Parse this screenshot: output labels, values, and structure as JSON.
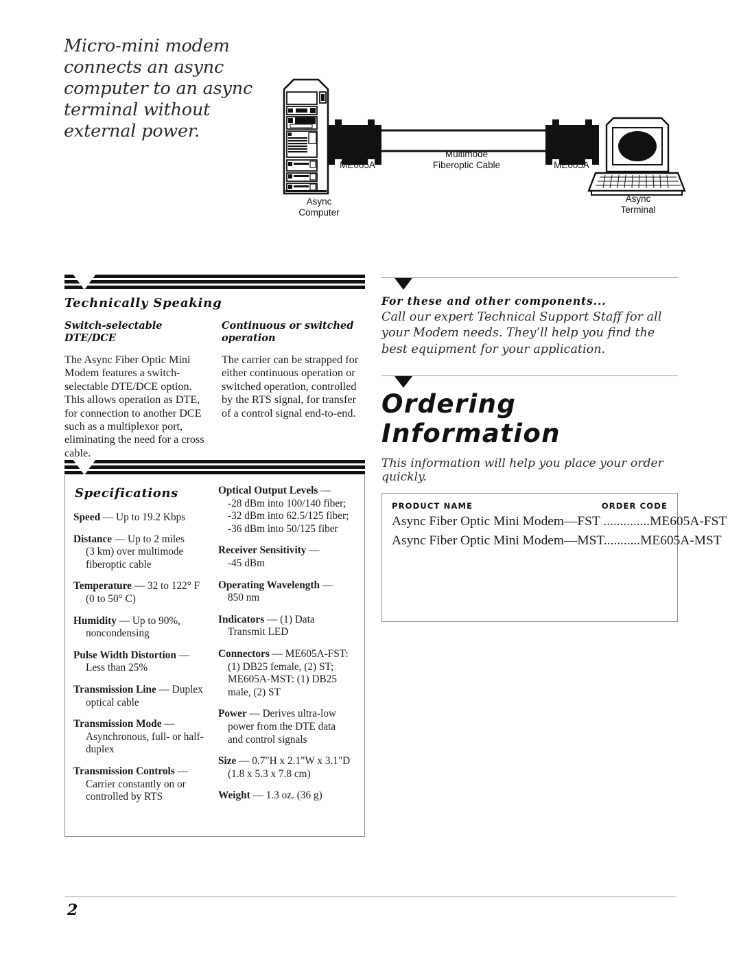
{
  "headline": "Micro-mini modem connects an async computer to an async terminal without external power.",
  "diagram": {
    "labels": [
      {
        "name": "async-computer",
        "text": "Async\nComputer"
      },
      {
        "name": "left-modem",
        "text": "ME605A"
      },
      {
        "name": "fiberoptic-cable",
        "text": "Multimode\nFiberoptic Cable"
      },
      {
        "name": "right-modem",
        "text": "ME605A"
      },
      {
        "name": "async-terminal",
        "text": "Async\nTerminal"
      }
    ]
  },
  "technically_speaking": {
    "title": "Technically Speaking",
    "columns": [
      {
        "subhead": "Switch-selectable DTE/DCE",
        "body": "The Async Fiber Optic Mini Modem features a switch-selectable DTE/DCE option. This allows operation as DTE, for connection to another DCE such as a multiplexor port, eliminating the need for a cross cable."
      },
      {
        "subhead": "Continuous or switched operation",
        "body": "The carrier can be strapped for either continuous operation or switched operation, controlled by the RTS signal, for transfer of a control signal end-to-end."
      }
    ]
  },
  "specifications": {
    "title": "Specifications",
    "left_items": [
      {
        "label": "Speed",
        "value": " — Up to 19.2 Kbps",
        "cont": ""
      },
      {
        "label": "Distance",
        "value": " — Up to 2 miles",
        "cont": "(3 km) over multimode fiberoptic cable"
      },
      {
        "label": "Temperature",
        "value": " — 32 to 122° F",
        "cont": "(0 to 50° C)"
      },
      {
        "label": "Humidity",
        "value": " — Up to 90%,",
        "cont": "noncondensing"
      },
      {
        "label": "Pulse Width Distortion",
        "value": " —",
        "cont": "Less than 25%"
      },
      {
        "label": "Transmission Line",
        "value": " — Duplex",
        "cont": "optical cable"
      },
      {
        "label": "Transmission Mode",
        "value": " —",
        "cont": "Asynchronous, full- or half-duplex"
      },
      {
        "label": "Transmission Controls",
        "value": " —",
        "cont": "Carrier constantly on or controlled by RTS"
      }
    ],
    "right_items": [
      {
        "label": "Optical Output Levels",
        "value": " —",
        "cont": "-28 dBm into 100/140 fiber; -32 dBm into 62.5/125 fiber; -36 dBm into 50/125 fiber"
      },
      {
        "label": "Receiver Sensitivity",
        "value": " —",
        "cont": "-45 dBm"
      },
      {
        "label": "Operating Wavelength",
        "value": " —",
        "cont": "850 nm"
      },
      {
        "label": "Indicators",
        "value": " — (1) Data",
        "cont": "Transmit LED"
      },
      {
        "label": "Connectors",
        "value": " — ME605A-FST:",
        "cont": "(1) DB25 female, (2) ST; ME605A-MST: (1) DB25 male, (2) ST"
      },
      {
        "label": "Power",
        "value": " — Derives ultra-low",
        "cont": "power from the DTE data and control signals"
      },
      {
        "label": "Size",
        "value": " — 0.7\"H x 2.1\"W x 3.1\"D",
        "cont": "(1.8 x 5.3 x 7.8 cm)"
      },
      {
        "label": "Weight",
        "value": " — 1.3 oz. (36 g)",
        "cont": ""
      }
    ]
  },
  "components": {
    "heading": "For these and other components...",
    "body": "Call our expert Technical Support Staff for all your Modem needs. They’ll help you find the best equipment for your application."
  },
  "ordering": {
    "title": "Ordering Information",
    "subtitle": "This information will help you place your order quickly.",
    "col_product": "PRODUCT NAME",
    "col_code": "ORDER CODE",
    "rows": [
      "Async Fiber Optic Mini Modem—FST ..............ME605A-FST",
      "Async Fiber Optic Mini Modem—MST...........ME605A-MST"
    ]
  },
  "footer": {
    "page_number": "2"
  },
  "colors": {
    "ink": "#111111",
    "rule": "#9a9a9a",
    "box_border": "#8d8d8d"
  }
}
